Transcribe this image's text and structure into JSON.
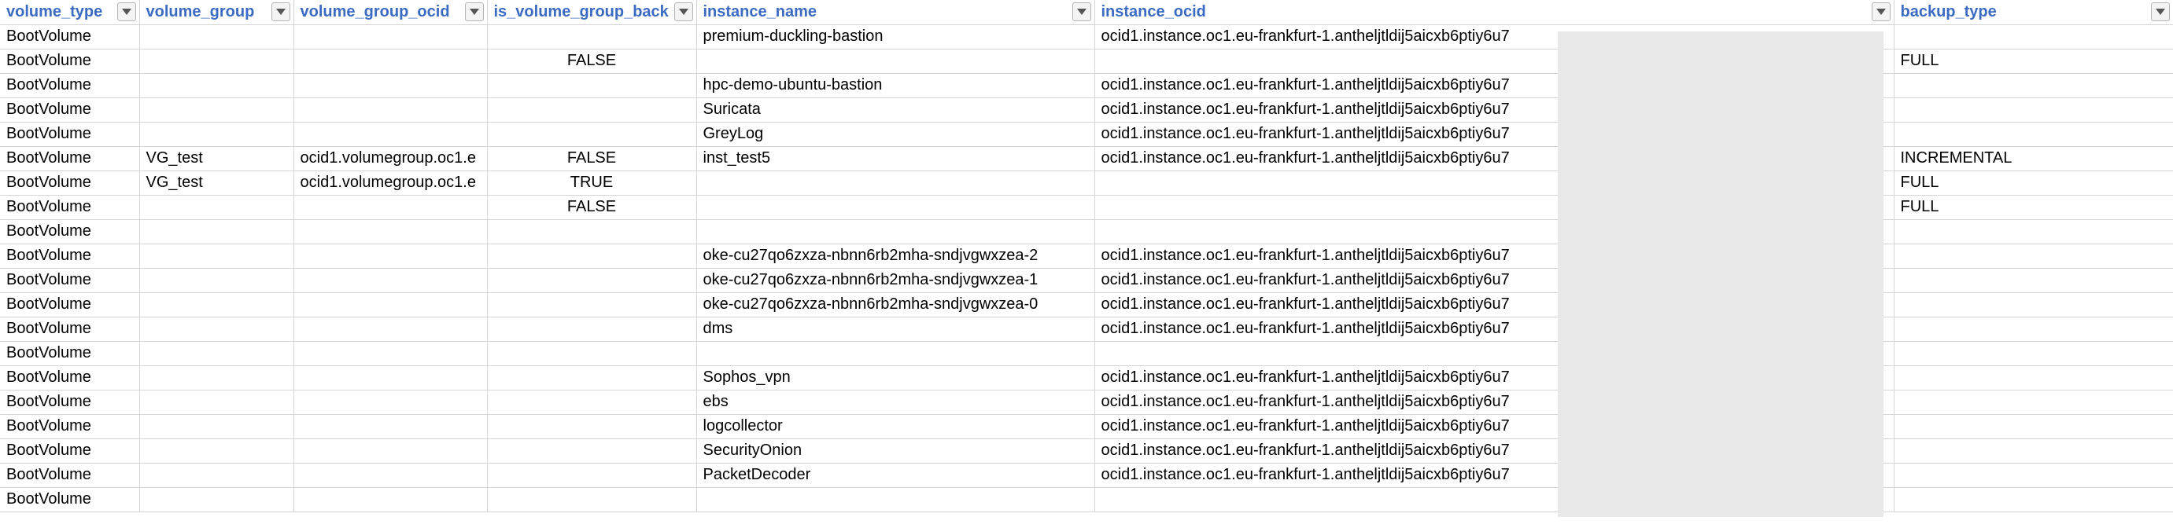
{
  "columns": [
    {
      "label": "volume_type"
    },
    {
      "label": "volume_group"
    },
    {
      "label": "volume_group_ocid"
    },
    {
      "label": "is_volume_group_back"
    },
    {
      "label": "instance_name"
    },
    {
      "label": "instance_ocid"
    },
    {
      "label": "backup_type"
    }
  ],
  "filter_icon": "chevron-down-icon",
  "rows": [
    [
      "BootVolume",
      "",
      "",
      "",
      "premium-duckling-bastion",
      "ocid1.instance.oc1.eu-frankfurt-1.antheljtldij5aicxb6ptiy6u7",
      ""
    ],
    [
      "BootVolume",
      "",
      "",
      "FALSE",
      "",
      "",
      "FULL"
    ],
    [
      "BootVolume",
      "",
      "",
      "",
      "hpc-demo-ubuntu-bastion",
      "ocid1.instance.oc1.eu-frankfurt-1.antheljtldij5aicxb6ptiy6u7",
      ""
    ],
    [
      "BootVolume",
      "",
      "",
      "",
      "Suricata",
      "ocid1.instance.oc1.eu-frankfurt-1.antheljtldij5aicxb6ptiy6u7",
      ""
    ],
    [
      "BootVolume",
      "",
      "",
      "",
      "GreyLog",
      "ocid1.instance.oc1.eu-frankfurt-1.antheljtldij5aicxb6ptiy6u7",
      ""
    ],
    [
      "BootVolume",
      "VG_test",
      "ocid1.volumegroup.oc1.e",
      "FALSE",
      "inst_test5",
      "ocid1.instance.oc1.eu-frankfurt-1.antheljtldij5aicxb6ptiy6u7",
      "INCREMENTAL"
    ],
    [
      "BootVolume",
      "VG_test",
      "ocid1.volumegroup.oc1.e",
      "TRUE",
      "",
      "",
      "FULL"
    ],
    [
      "BootVolume",
      "",
      "",
      "FALSE",
      "",
      "",
      "FULL"
    ],
    [
      "BootVolume",
      "",
      "",
      "",
      "",
      "",
      ""
    ],
    [
      "BootVolume",
      "",
      "",
      "",
      "oke-cu27qo6zxza-nbnn6rb2mha-sndjvgwxzea-2",
      "ocid1.instance.oc1.eu-frankfurt-1.antheljtldij5aicxb6ptiy6u7",
      ""
    ],
    [
      "BootVolume",
      "",
      "",
      "",
      "oke-cu27qo6zxza-nbnn6rb2mha-sndjvgwxzea-1",
      "ocid1.instance.oc1.eu-frankfurt-1.antheljtldij5aicxb6ptiy6u7",
      ""
    ],
    [
      "BootVolume",
      "",
      "",
      "",
      "oke-cu27qo6zxza-nbnn6rb2mha-sndjvgwxzea-0",
      "ocid1.instance.oc1.eu-frankfurt-1.antheljtldij5aicxb6ptiy6u7",
      ""
    ],
    [
      "BootVolume",
      "",
      "",
      "",
      "dms",
      "ocid1.instance.oc1.eu-frankfurt-1.antheljtldij5aicxb6ptiy6u7",
      ""
    ],
    [
      "BootVolume",
      "",
      "",
      "",
      "",
      "",
      ""
    ],
    [
      "BootVolume",
      "",
      "",
      "",
      "Sophos_vpn",
      "ocid1.instance.oc1.eu-frankfurt-1.antheljtldij5aicxb6ptiy6u7",
      ""
    ],
    [
      "BootVolume",
      "",
      "",
      "",
      "ebs",
      "ocid1.instance.oc1.eu-frankfurt-1.antheljtldij5aicxb6ptiy6u7",
      ""
    ],
    [
      "BootVolume",
      "",
      "",
      "",
      "logcollector",
      "ocid1.instance.oc1.eu-frankfurt-1.antheljtldij5aicxb6ptiy6u7",
      ""
    ],
    [
      "BootVolume",
      "",
      "",
      "",
      "SecurityOnion",
      "ocid1.instance.oc1.eu-frankfurt-1.antheljtldij5aicxb6ptiy6u7",
      ""
    ],
    [
      "BootVolume",
      "",
      "",
      "",
      "PacketDecoder",
      "ocid1.instance.oc1.eu-frankfurt-1.antheljtldij5aicxb6ptiy6u7",
      ""
    ],
    [
      "BootVolume",
      "",
      "",
      "",
      "",
      "",
      ""
    ]
  ],
  "colors": {
    "header_text": "#3b6bc2",
    "gridline": "#d4d4d4",
    "redaction": "#e8e8e8"
  }
}
